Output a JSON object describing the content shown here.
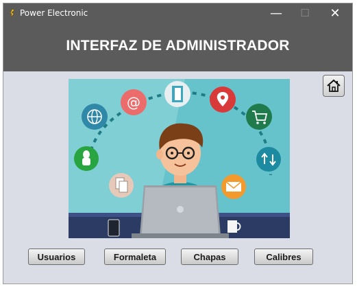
{
  "window": {
    "title": "Power Electronic",
    "controls": {
      "minimize": "—",
      "maximize": "☐",
      "close": "✕"
    }
  },
  "header": {
    "title": "INTERFAZ DE ADMINISTRADOR"
  },
  "home_button": {
    "icon": "home-icon"
  },
  "buttons": {
    "usuarios": "Usuarios",
    "formaleta": "Formaleta",
    "chapas": "Chapas",
    "calibres": "Calibres"
  },
  "colors": {
    "titlebar": "#5b5b5b",
    "panel": "#dadce6",
    "illustration_bg": "#7fcfd4",
    "desk": "#2b3b63"
  }
}
